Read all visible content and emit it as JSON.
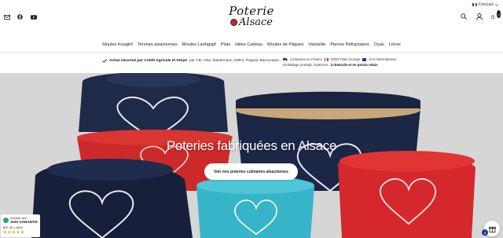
{
  "header": {
    "logo_line1": "Poterie",
    "logo_line2": "Alsace",
    "language": "Français",
    "cart_count": "0"
  },
  "nav": {
    "items": [
      "Moules Kouglof",
      "Terrines alsaciennes",
      "Moules Lanhgopf",
      "Plats",
      "Idées Cadeau",
      "Moules de Pâques",
      "Vaisselle",
      "Pierres Réfractaires",
      "Oyas",
      "Livres"
    ]
  },
  "info": {
    "secure_bold": "Achat sécurisé par Crédit Agricole et Stripe",
    "secure_rest": "par CB, Visa, Mastercard, AMEX, Paypal, Bancontact...",
    "shipping_line1_a": "Livraisons en France",
    "shipping_line1_b": "DOM TOM, Europe",
    "shipping_line1_c": "et à l'international",
    "shipping_line2_a": "Emballage protégé, livraisons",
    "shipping_line2_b": "à domicile et en points relais"
  },
  "hero": {
    "title": "Poteries fabriquées en Alsace",
    "button": "Voir nos poteries culinaires alsaciennes"
  },
  "badge": {
    "small": "Société des",
    "title": "AVIS GARANTIS",
    "score": "5.0",
    "count": "30.1 AVIS"
  },
  "floating": {
    "count": "4"
  },
  "colors": {
    "accent_red": "#d4282c",
    "navy": "#1a2a4a",
    "turquoise": "#36b5c9"
  }
}
